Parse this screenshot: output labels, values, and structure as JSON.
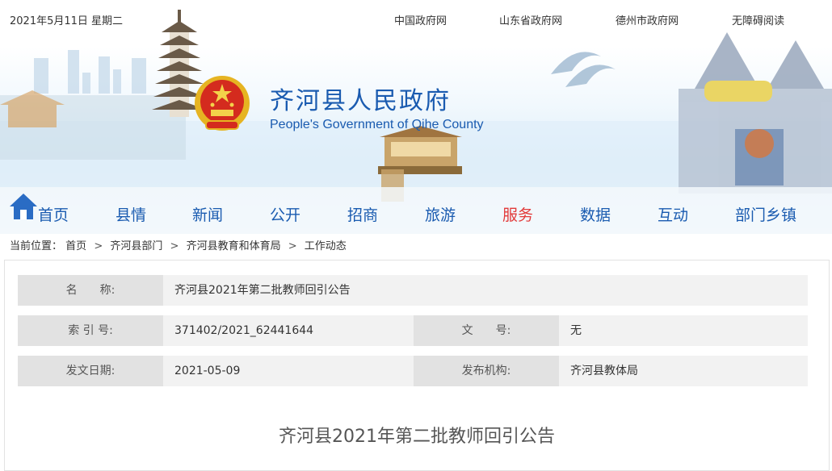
{
  "header": {
    "date": "2021年5月11日 星期二",
    "top_links": [
      "中国政府网",
      "山东省政府网",
      "德州市政府网",
      "无障碍阅读"
    ],
    "title_cn": "齐河县人民政府",
    "title_en": "People's Government of Qihe County"
  },
  "nav": {
    "items": [
      "首页",
      "县情",
      "新闻",
      "公开",
      "招商",
      "旅游",
      "服务",
      "数据",
      "互动",
      "部门乡镇"
    ],
    "active_index": 6,
    "colors": {
      "normal": "#1a5bb0",
      "active": "#e23a3a"
    }
  },
  "breadcrumb": {
    "prefix": "当前位置：",
    "items": [
      "首页",
      "齐河县部门",
      "齐河县教育和体育局",
      "工作动态"
    ],
    "separator": ">"
  },
  "meta": {
    "name_label": "名　　称:",
    "name_value": "齐河县2021年第二批教师回引公告",
    "index_label": "索 引 号:",
    "index_value": "371402/2021_62441644",
    "doc_no_label": "文　　号:",
    "doc_no_value": "无",
    "date_label": "发文日期:",
    "date_value": "2021-05-09",
    "org_label": "发布机构:",
    "org_value": "齐河县教体局"
  },
  "article": {
    "title": "齐河县2021年第二批教师回引公告"
  }
}
